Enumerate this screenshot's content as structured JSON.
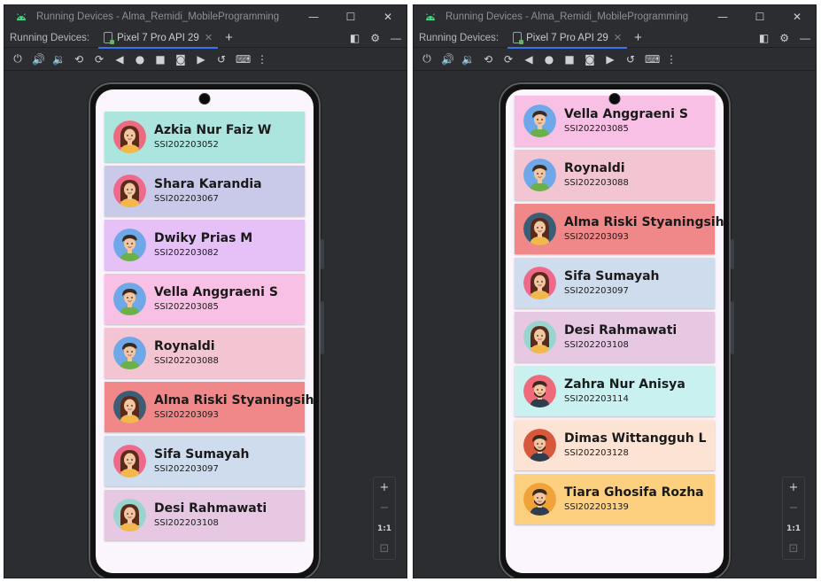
{
  "window_title": "Running Devices - Alma_Remidi_MobileProgramming",
  "tabs_label": "Running Devices:",
  "device_tab": "Pixel 7 Pro API 29",
  "zoom": {
    "plus": "+",
    "minus": "−",
    "one_to_one": "1:1"
  },
  "colors": {
    "accent": "#3574f0",
    "ide_bg": "#2b2d30"
  },
  "left_cards": [
    {
      "name": "Azkia Nur Faiz W",
      "nim": "SSI202203052",
      "bg": "#ace5dd",
      "avatar_bg": "#f06a7f",
      "avatar": "girl"
    },
    {
      "name": "Shara Karandia",
      "nim": "SSI202203067",
      "bg": "#c9c9e9",
      "avatar_bg": "#ef6a8a",
      "avatar": "girl"
    },
    {
      "name": "Dwiky Prias M",
      "nim": "SSI202203082",
      "bg": "#e6c1f8",
      "avatar_bg": "#6fa8e8",
      "avatar": "boy"
    },
    {
      "name": "Vella Anggraeni S",
      "nim": "SSI202203085",
      "bg": "#f9c0e5",
      "avatar_bg": "#6fa8e8",
      "avatar": "boy"
    },
    {
      "name": "Roynaldi",
      "nim": "SSI202203088",
      "bg": "#f3c5d2",
      "avatar_bg": "#6fa8e8",
      "avatar": "boy"
    },
    {
      "name": "Alma Riski Styaningsih",
      "nim": "SSI202203093",
      "bg": "#f08788",
      "avatar_bg": "#3b5d76",
      "avatar": "girl"
    },
    {
      "name": "Sifa Sumayah",
      "nim": "SSI202203097",
      "bg": "#cfdcee",
      "avatar_bg": "#ef6a8a",
      "avatar": "girl"
    },
    {
      "name": "Desi Rahmawati",
      "nim": "SSI202203108",
      "bg": "#e6c8e2",
      "avatar_bg": "#9ad4cf",
      "avatar": "girl"
    }
  ],
  "right_cards": [
    {
      "name": "Vella Anggraeni S",
      "nim": "SSI202203085",
      "bg": "#f9c0e5",
      "avatar_bg": "#6fa8e8",
      "avatar": "boy"
    },
    {
      "name": "Roynaldi",
      "nim": "SSI202203088",
      "bg": "#f3c5d2",
      "avatar_bg": "#6fa8e8",
      "avatar": "boy"
    },
    {
      "name": "Alma Riski Styaningsih",
      "nim": "SSI202203093",
      "bg": "#f08788",
      "avatar_bg": "#3b5d76",
      "avatar": "girl"
    },
    {
      "name": "Sifa Sumayah",
      "nim": "SSI202203097",
      "bg": "#cfdcee",
      "avatar_bg": "#ef6a8a",
      "avatar": "girl"
    },
    {
      "name": "Desi Rahmawati",
      "nim": "SSI202203108",
      "bg": "#e6c8e2",
      "avatar_bg": "#9ad4cf",
      "avatar": "girl"
    },
    {
      "name": "Zahra Nur Anisya",
      "nim": "SSI202203114",
      "bg": "#c8f1ef",
      "avatar_bg": "#ef6a7a",
      "avatar": "man"
    },
    {
      "name": "Dimas Wittangguh L",
      "nim": "SSI202203128",
      "bg": "#fde3d4",
      "avatar_bg": "#d8583c",
      "avatar": "man"
    },
    {
      "name": "Tiara Ghosifa Rozha",
      "nim": "SSI202203139",
      "bg": "#fdd07f",
      "avatar_bg": "#f0a33a",
      "avatar": "man"
    }
  ]
}
